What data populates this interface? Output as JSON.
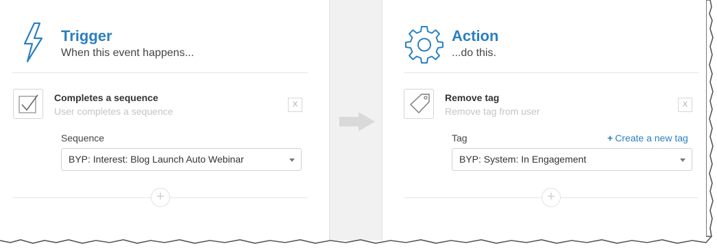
{
  "trigger": {
    "title": "Trigger",
    "subtitle": "When this event happens...",
    "icon": "lightning-bolt-icon",
    "item": {
      "icon": "checkmark-icon",
      "title": "Completes a sequence",
      "description": "User completes a sequence",
      "remove_label": "X"
    },
    "field": {
      "label": "Sequence",
      "selected": "BYP: Interest: Blog Launch Auto Webinar"
    },
    "add_label": "+"
  },
  "connector": {
    "icon": "arrow-right-icon"
  },
  "action": {
    "title": "Action",
    "subtitle": "...do this.",
    "icon": "gear-icon",
    "item": {
      "icon": "tag-icon",
      "title": "Remove tag",
      "description": "Remove tag from user",
      "remove_label": "X"
    },
    "field": {
      "label": "Tag",
      "create_link": "Create a new tag",
      "selected": "BYP: System: In Engagement"
    },
    "add_label": "+"
  },
  "colors": {
    "accent": "#2a7fc1",
    "muted": "#c4c4c4"
  }
}
